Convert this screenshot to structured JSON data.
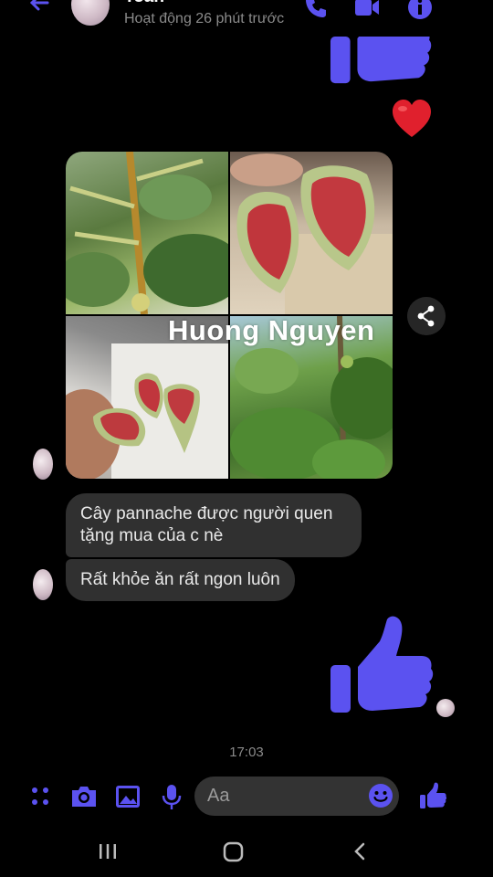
{
  "header": {
    "name": "Toàn",
    "status": "Hoạt động 26 phút trước",
    "icons": [
      "back-arrow-icon",
      "phone-icon",
      "video-icon",
      "info-icon"
    ]
  },
  "messages": {
    "photo_watermark": "Huong Nguyen",
    "bubble_1": "Cây pannache được người quen tặng mua của c nè",
    "bubble_2": "Rất khỏe ăn rất ngon luôn",
    "timestamp": "17:03"
  },
  "composer": {
    "placeholder": "Aa",
    "icons": [
      "menu-dots-icon",
      "camera-icon",
      "gallery-icon",
      "mic-icon",
      "emoji-icon",
      "thumbs-up-icon"
    ]
  },
  "theme": {
    "accent": "#5b52f0",
    "bubble_bg": "#303030",
    "background": "#000000"
  }
}
